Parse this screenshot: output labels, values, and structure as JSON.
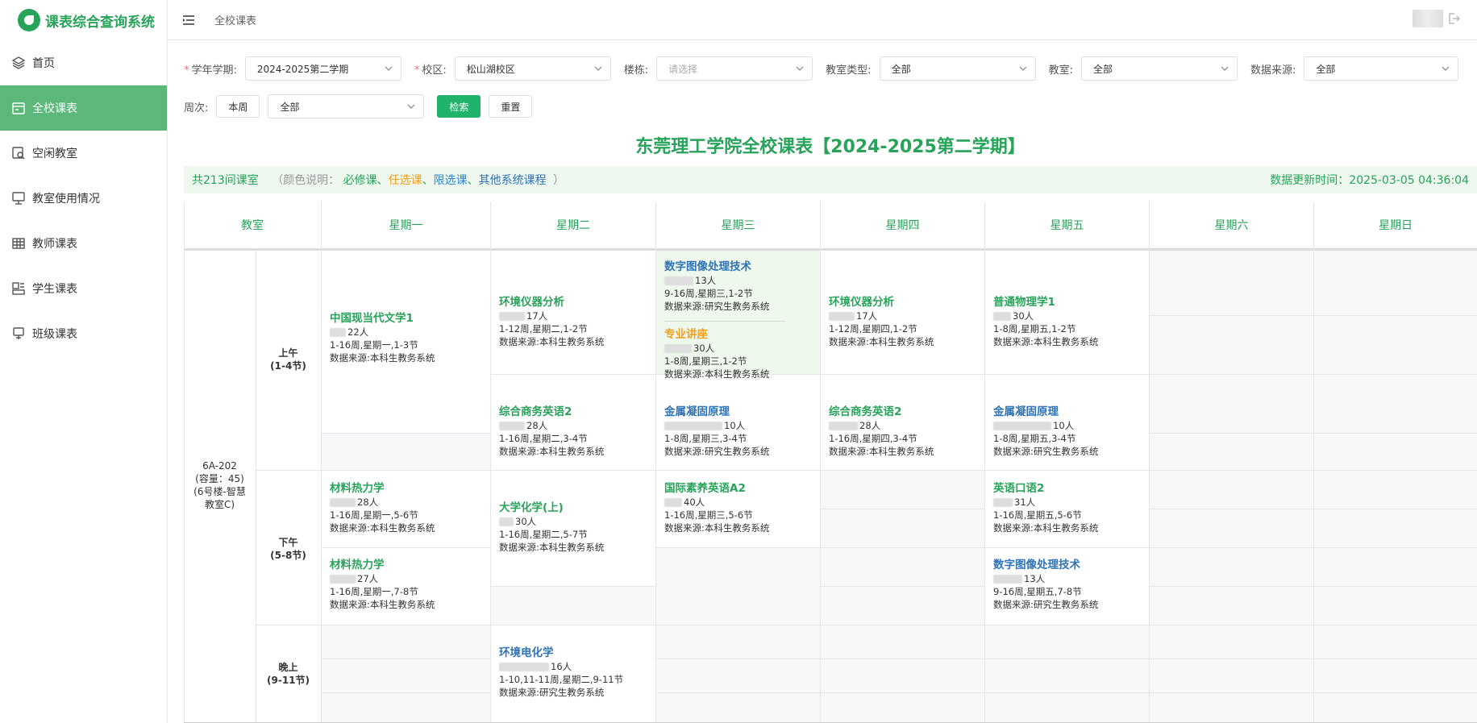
{
  "app": {
    "title": "课表综合查询系统"
  },
  "sidebar": {
    "items": [
      {
        "label": "首页",
        "icon": "layers-icon",
        "active": false
      },
      {
        "label": "全校课表",
        "icon": "calendar-icon",
        "active": true
      },
      {
        "label": "空闲教室",
        "icon": "room-search-icon",
        "active": false
      },
      {
        "label": "教室使用情况",
        "icon": "presentation-icon",
        "active": false
      },
      {
        "label": "教师课表",
        "icon": "grid-table-icon",
        "active": false
      },
      {
        "label": "学生课表",
        "icon": "student-card-icon",
        "active": false
      },
      {
        "label": "班级课表",
        "icon": "class-icon",
        "active": false
      }
    ]
  },
  "topbar": {
    "breadcrumb": "全校课表"
  },
  "filters": {
    "term_label": "学年学期:",
    "term_value": "2024-2025第二学期",
    "campus_label": "校区:",
    "campus_value": "松山湖校区",
    "building_label": "楼栋:",
    "building_placeholder": "请选择",
    "roomtype_label": "教室类型:",
    "roomtype_value": "全部",
    "room_label": "教室:",
    "room_value": "全部",
    "source_label": "数据来源:",
    "source_value": "全部",
    "week_label": "周次:",
    "this_week_btn": "本周",
    "week_value": "全部",
    "search_btn": "检索",
    "reset_btn": "重置"
  },
  "title": "东莞理工学院全校课表【2024-2025第二学期】",
  "info": {
    "count": "共213间课室",
    "legend_label": "（颜色说明：",
    "legend_required": "必修课",
    "legend_optional": "任选课",
    "legend_limited": "限选课",
    "legend_other": "其他系统课程",
    "legend_close": "）",
    "sep": "、",
    "update_time": "数据更新时间：2025-03-05 04:36:04",
    "colors": {
      "required": "#27a35a",
      "optional": "#f0a020",
      "limited": "#2f86cf",
      "other": "#2f74b8"
    }
  },
  "table": {
    "headers": [
      "教室",
      "星期一",
      "星期二",
      "星期三",
      "星期四",
      "星期五",
      "星期六",
      "星期日"
    ],
    "room": {
      "line1": "6A-202",
      "line2": "(容量：45)",
      "line3": "(6号楼-智慧",
      "line4": "教室C)"
    },
    "periods": [
      {
        "name": "上午",
        "range": "(1-4节)"
      },
      {
        "name": "下午",
        "range": "(5-8节)"
      },
      {
        "name": "晚上",
        "range": "(9-11节)"
      }
    ],
    "courses": {
      "mon_am": {
        "name": "中国现当代文学1",
        "count": "22人",
        "time": "1-16周,星期一,1-3节",
        "source": "数据来源:本科生教务系统"
      },
      "tue_am1": {
        "name": "环境仪器分析",
        "count": "17人",
        "time": "1-12周,星期二,1-2节",
        "source": "数据来源:本科生教务系统"
      },
      "wed_am_a": {
        "name": "数字图像处理技术",
        "count": "13人",
        "time": "9-16周,星期三,1-2节",
        "source": "数据来源:研究生教务系统"
      },
      "wed_am_b": {
        "name": "专业讲座",
        "count": "30人",
        "time": "1-8周,星期三,1-2节",
        "source": "数据来源:本科生教务系统"
      },
      "thu_am1": {
        "name": "环境仪器分析",
        "count": "17人",
        "time": "1-12周,星期四,1-2节",
        "source": "数据来源:本科生教务系统"
      },
      "fri_am1": {
        "name": "普通物理学1",
        "count": "30人",
        "time": "1-8周,星期五,1-2节",
        "source": "数据来源:本科生教务系统"
      },
      "tue_am2": {
        "name": "综合商务英语2",
        "count": "28人",
        "time": "1-16周,星期二,3-4节",
        "source": "数据来源:本科生教务系统"
      },
      "wed_am2": {
        "name": "金属凝固原理",
        "count": "10人",
        "time": "1-8周,星期三,3-4节",
        "source": "数据来源:研究生教务系统"
      },
      "thu_am2": {
        "name": "综合商务英语2",
        "count": "28人",
        "time": "1-16周,星期四,3-4节",
        "source": "数据来源:本科生教务系统"
      },
      "fri_am2": {
        "name": "金属凝固原理",
        "count": "10人",
        "time": "1-8周,星期五,3-4节",
        "source": "数据来源:研究生教务系统"
      },
      "mon_pm1": {
        "name": "材料热力学",
        "count": "28人",
        "time": "1-16周,星期一,5-6节",
        "source": "数据来源:本科生教务系统"
      },
      "tue_pm": {
        "name": "大学化学(上)",
        "count": "30人",
        "time": "1-16周,星期二,5-7节",
        "source": "数据来源:本科生教务系统"
      },
      "wed_pm1": {
        "name": "国际素养英语A2",
        "count": "40人",
        "time": "1-16周,星期三,5-6节",
        "source": "数据来源:本科生教务系统"
      },
      "fri_pm1": {
        "name": "英语口语2",
        "count": "31人",
        "time": "1-16周,星期五,5-6节",
        "source": "数据来源:本科生教务系统"
      },
      "mon_pm2": {
        "name": "材料热力学",
        "count": "27人",
        "time": "1-16周,星期一,7-8节",
        "source": "数据来源:本科生教务系统"
      },
      "fri_pm2": {
        "name": "数字图像处理技术",
        "count": "13人",
        "time": "9-16周,星期五,7-8节",
        "source": "数据来源:研究生教务系统"
      },
      "tue_ev": {
        "name": "环境电化学",
        "count": "16人",
        "time": "1-10,11-11周,星期二,9-11节",
        "source": "数据来源:研究生教务系统"
      }
    }
  }
}
